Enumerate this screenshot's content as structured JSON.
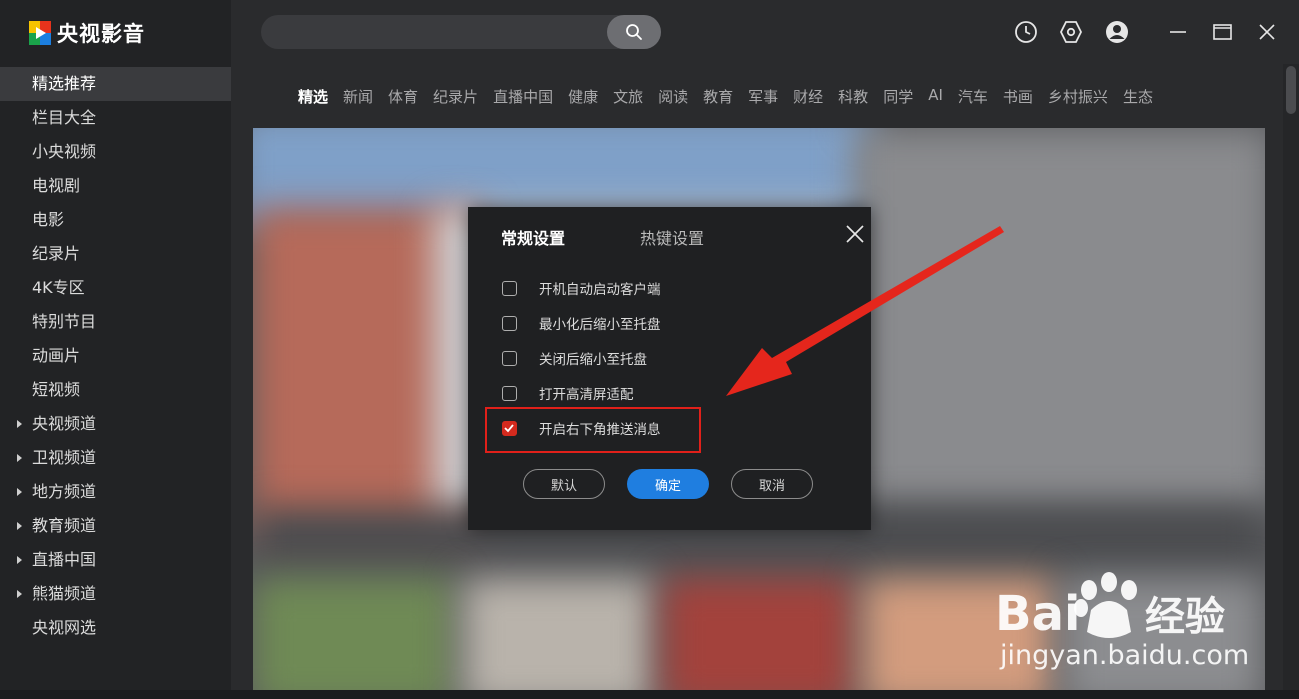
{
  "app": {
    "name": "央视影音"
  },
  "sidebar": {
    "items": [
      {
        "label": "精选推荐",
        "active": true,
        "expandable": false
      },
      {
        "label": "栏目大全",
        "active": false,
        "expandable": false
      },
      {
        "label": "小央视频",
        "active": false,
        "expandable": false
      },
      {
        "label": "电视剧",
        "active": false,
        "expandable": false
      },
      {
        "label": "电影",
        "active": false,
        "expandable": false
      },
      {
        "label": "纪录片",
        "active": false,
        "expandable": false
      },
      {
        "label": "4K专区",
        "active": false,
        "expandable": false
      },
      {
        "label": "特别节目",
        "active": false,
        "expandable": false
      },
      {
        "label": "动画片",
        "active": false,
        "expandable": false
      },
      {
        "label": "短视频",
        "active": false,
        "expandable": false
      },
      {
        "label": "央视频道",
        "active": false,
        "expandable": true
      },
      {
        "label": "卫视频道",
        "active": false,
        "expandable": true
      },
      {
        "label": "地方频道",
        "active": false,
        "expandable": true
      },
      {
        "label": "教育频道",
        "active": false,
        "expandable": true
      },
      {
        "label": "直播中国",
        "active": false,
        "expandable": true
      },
      {
        "label": "熊猫频道",
        "active": false,
        "expandable": true
      },
      {
        "label": "央视网选",
        "active": false,
        "expandable": false
      }
    ]
  },
  "search": {
    "value": "",
    "placeholder": ""
  },
  "toolbar_icons": [
    "history-icon",
    "settings-icon",
    "user-avatar-icon",
    "minimize-icon",
    "maximize-icon",
    "close-icon"
  ],
  "categories": [
    "精选",
    "新闻",
    "体育",
    "纪录片",
    "直播中国",
    "健康",
    "文旅",
    "阅读",
    "教育",
    "军事",
    "财经",
    "科教",
    "同学",
    "AI",
    "汽车",
    "书画",
    "乡村振兴",
    "生态"
  ],
  "active_category": "精选",
  "dialog": {
    "tabs": {
      "general": "常规设置",
      "hotkey": "热键设置"
    },
    "options": [
      {
        "label": "开机自动启动客户端",
        "checked": false
      },
      {
        "label": "最小化后缩小至托盘",
        "checked": false
      },
      {
        "label": "关闭后缩小至托盘",
        "checked": false
      },
      {
        "label": "打开高清屏适配",
        "checked": false
      },
      {
        "label": "开启右下角推送消息",
        "checked": true
      }
    ],
    "buttons": {
      "default": "默认",
      "ok": "确定",
      "cancel": "取消"
    }
  },
  "colors": {
    "accent_blue": "#1f7ee0",
    "check_red": "#d42a1e",
    "annotation_red": "#e0201a"
  },
  "watermark": {
    "brand": "Bai度经验",
    "url": "jingyan.baidu.com"
  }
}
